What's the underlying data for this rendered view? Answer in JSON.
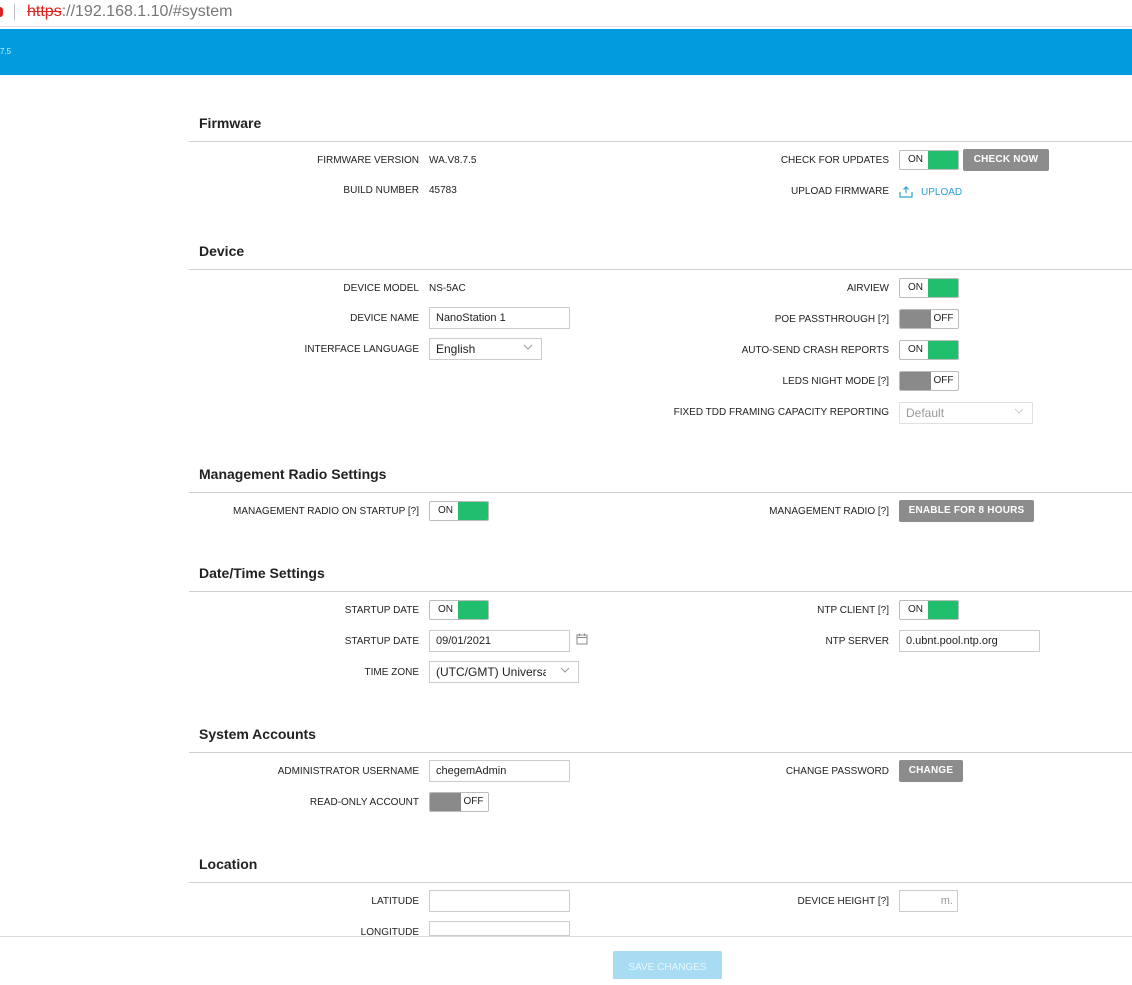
{
  "browser": {
    "url_scheme": "https",
    "url_rest": "://192.168.1.10/#system"
  },
  "header": {
    "version_fragment": "7.5"
  },
  "sections": {
    "firmware": "Firmware",
    "device": "Device",
    "management_radio": "Management Radio Settings",
    "datetime": "Date/Time Settings",
    "accounts": "System Accounts",
    "location": "Location"
  },
  "firmware": {
    "version_label": "FIRMWARE VERSION",
    "version_value": "WA.V8.7.5",
    "build_label": "BUILD NUMBER",
    "build_value": "45783",
    "check_updates_label": "CHECK FOR UPDATES",
    "check_updates_state": "ON",
    "check_now_label": "CHECK NOW",
    "upload_label": "UPLOAD FIRMWARE",
    "upload_link": "UPLOAD"
  },
  "device": {
    "model_label": "DEVICE MODEL",
    "model_value": "NS-5AC",
    "name_label": "DEVICE NAME",
    "name_value": "NanoStation 1",
    "language_label": "INTERFACE LANGUAGE",
    "language_value": "English",
    "airview_label": "AIRVIEW",
    "airview_state": "ON",
    "poe_label": "POE PASSTHROUGH [?]",
    "poe_state": "OFF",
    "crash_label": "AUTO-SEND CRASH REPORTS",
    "crash_state": "ON",
    "leds_label": "LEDS NIGHT MODE [?]",
    "leds_state": "OFF",
    "tdd_label": "FIXED TDD FRAMING CAPACITY REPORTING",
    "tdd_value": "Default"
  },
  "management_radio": {
    "startup_label": "MANAGEMENT RADIO ON STARTUP [?]",
    "startup_state": "ON",
    "radio_label": "MANAGEMENT RADIO [?]",
    "enable_button": "ENABLE FOR 8 HOURS"
  },
  "datetime": {
    "startup_date_toggle_label": "STARTUP DATE",
    "startup_date_toggle_state": "ON",
    "startup_date_label": "STARTUP DATE",
    "startup_date_value": "09/01/2021",
    "timezone_label": "TIME ZONE",
    "timezone_value": "(UTC/GMT) Universal",
    "ntp_client_label": "NTP CLIENT [?]",
    "ntp_client_state": "ON",
    "ntp_server_label": "NTP SERVER",
    "ntp_server_value": "0.ubnt.pool.ntp.org"
  },
  "accounts": {
    "admin_label": "ADMINISTRATOR USERNAME",
    "admin_value": "chegemAdmin",
    "readonly_label": "READ-ONLY ACCOUNT",
    "readonly_state": "OFF",
    "password_label": "CHANGE PASSWORD",
    "change_button": "CHANGE"
  },
  "location": {
    "latitude_label": "LATITUDE",
    "latitude_value": "",
    "longitude_label": "LONGITUDE",
    "longitude_value": "",
    "height_label": "DEVICE HEIGHT [?]",
    "height_unit": "m."
  },
  "footer": {
    "save_label": "SAVE CHANGES"
  }
}
